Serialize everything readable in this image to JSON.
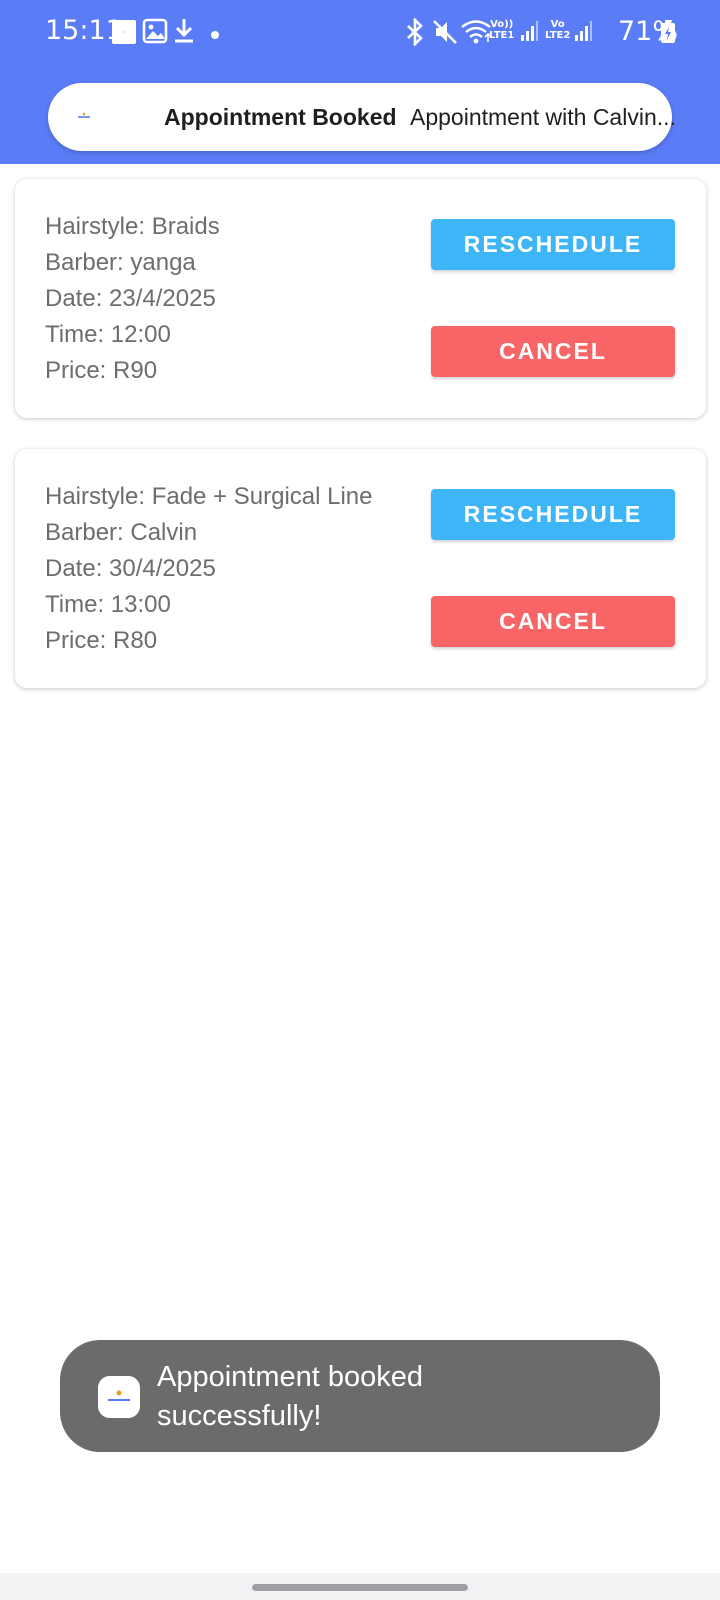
{
  "status_bar": {
    "time": "15:11",
    "battery": "71%",
    "sim1_label_top": "Vo))",
    "sim1_label_bottom": "LTE1",
    "sim2_label_top": "Vo",
    "sim2_label_bottom": "LTE2",
    "icons": [
      "barberbuzz-notification-icon",
      "image-icon",
      "download-icon",
      "dot-icon",
      "bluetooth-icon",
      "mute-icon",
      "wifi-icon",
      "signal-icon",
      "signal-icon",
      "battery-charging-icon"
    ]
  },
  "heads_up_notification": {
    "title": "Appointment Booked",
    "text": "Appointment with Calvin..."
  },
  "appointments": [
    {
      "hairstyle": "Hairstyle: Braids",
      "barber": "Barber: yanga",
      "date": "Date: 23/4/2025",
      "time": "Time: 12:00",
      "price": "Price: R90",
      "reschedule_label": "RESCHEDULE",
      "cancel_label": "CANCEL"
    },
    {
      "hairstyle": "Hairstyle: Fade + Surgical Line",
      "barber": "Barber: Calvin",
      "date": "Date: 30/4/2025",
      "time": "Time: 13:00",
      "price": "Price: R80",
      "reschedule_label": "RESCHEDULE",
      "cancel_label": "CANCEL"
    }
  ],
  "toast": {
    "message": "Appointment booked successfully!",
    "app_icon": "barberbuzz-app-icon"
  },
  "colors": {
    "header": "#5b7cf7",
    "reschedule": "#3db5f7",
    "cancel": "#f96467",
    "toast": "#6b6b6b"
  }
}
